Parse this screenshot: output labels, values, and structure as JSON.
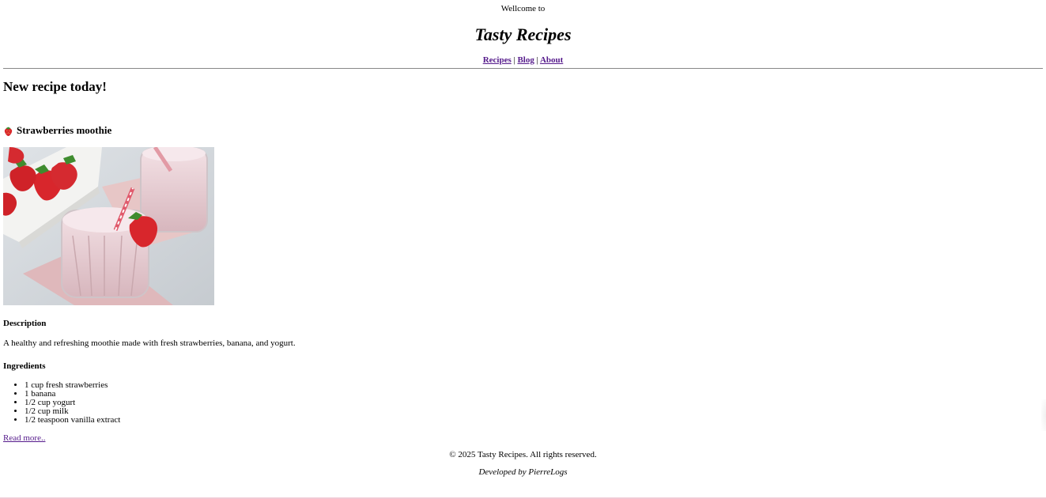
{
  "header": {
    "welcome": "Wellcome to",
    "site_title": "Tasty Recipes",
    "nav": [
      {
        "label": "Recipes"
      },
      {
        "label": "Blog"
      },
      {
        "label": "About"
      }
    ],
    "nav_separator": "|"
  },
  "main": {
    "heading": "New recipe today!",
    "recipe": {
      "icon": "strawberry-icon",
      "title": "Strawberries moothie",
      "image_alt": "strawberry-smoothie-photo",
      "description_label": "Description",
      "description": "A healthy and refreshing moothie made with fresh strawberries, banana, and yogurt.",
      "ingredients_label": "Ingredients",
      "ingredients": [
        "1 cup fresh strawberries",
        "1 banana",
        "1/2 cup yogurt",
        "1/2 cup milk",
        "1/2 teaspoon vanilla extract"
      ],
      "read_more": "Read more.."
    }
  },
  "footer": {
    "copyright": "© 2025 Tasty Recipes. All rights reserved.",
    "developer": "Developed by PierreLogs"
  },
  "colors": {
    "link_visited": "#551a8b",
    "rule": "#888888",
    "smoothie_pink": "#e8c9cf"
  }
}
